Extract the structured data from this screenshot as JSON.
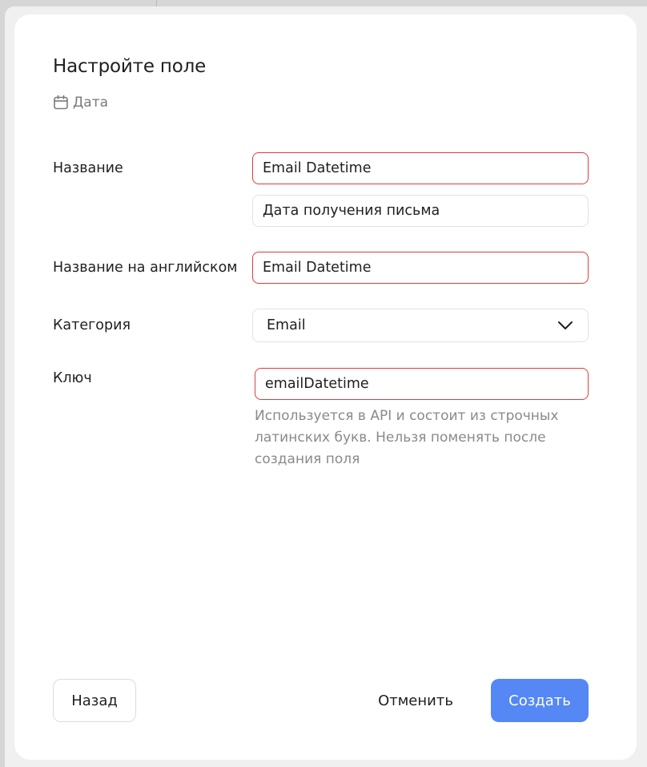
{
  "modal": {
    "title": "Настройте поле",
    "field_type": {
      "icon": "calendar-icon",
      "label": "Дата"
    }
  },
  "form": {
    "name": {
      "label": "Название",
      "value": "Email Datetime",
      "secondary_value": "Дата получения письма"
    },
    "english_name": {
      "label": "Название на английском",
      "value": "Email Datetime"
    },
    "category": {
      "label": "Категория",
      "selected": "Email",
      "icon": "chevron-down-icon"
    },
    "key": {
      "label": "Ключ",
      "value": "emailDatetime",
      "hint": "Используется в API и состоит из строчных латинских букв. Нельзя поменять после создания поля"
    }
  },
  "footer": {
    "back_label": "Назад",
    "cancel_label": "Отменить",
    "create_label": "Создать"
  },
  "colors": {
    "error_border": "#e23b3b",
    "primary": "#5588f5",
    "hint_text": "#8a8a8a"
  }
}
